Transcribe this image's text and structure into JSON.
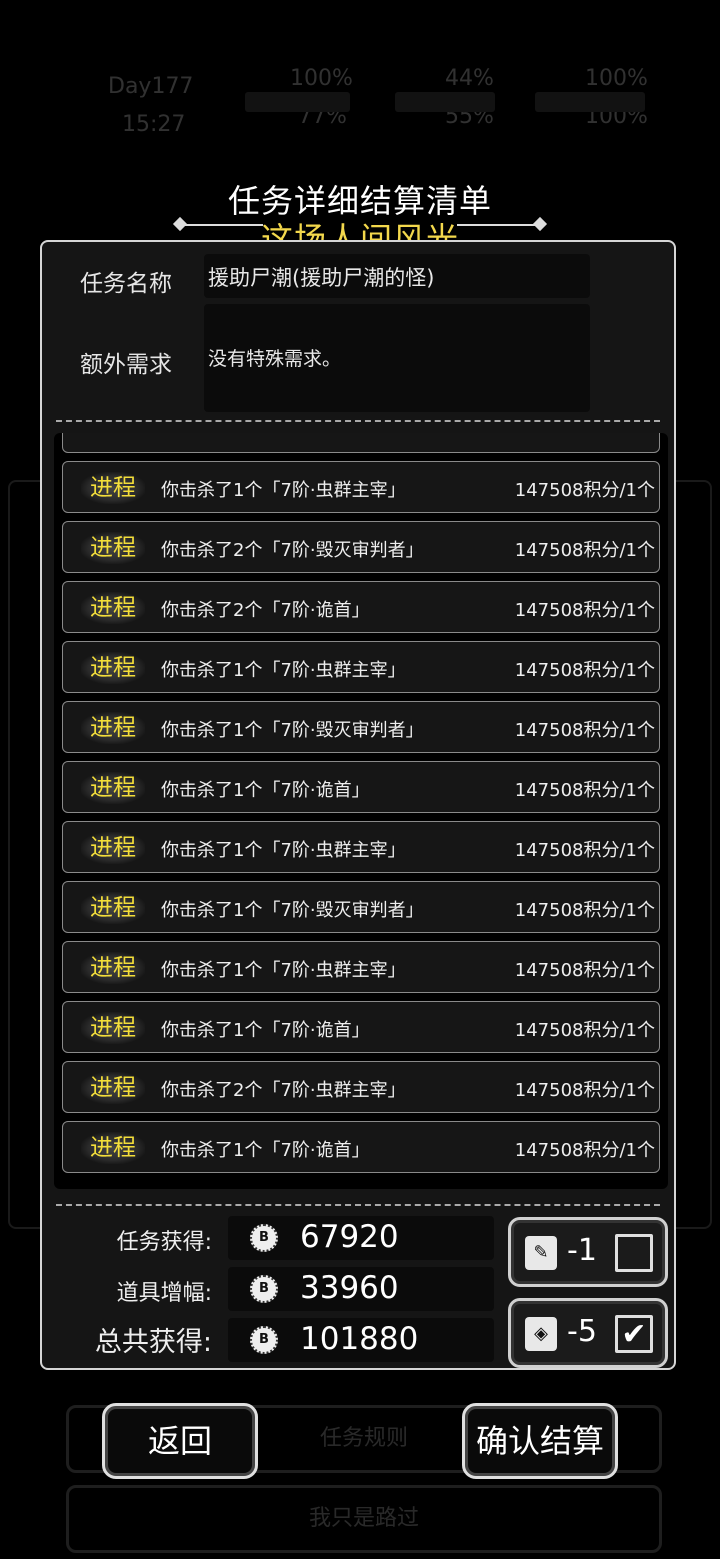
{
  "background": {
    "stats": [
      "Day177",
      "15:27",
      "100%",
      "77%",
      "44%",
      "55%",
      "100%",
      "100%"
    ],
    "center_button": "任务规则",
    "bottom_button": "我只是路过"
  },
  "header": {
    "title": "任务详细结算清单",
    "subtitle": "这场人间风光"
  },
  "task": {
    "name_label": "任务名称",
    "name_value": "援助尸潮(援助尸潮的怪)",
    "extra_label": "额外需求",
    "extra_value": "没有特殊需求。"
  },
  "progress": {
    "tag": "进程",
    "rows": [
      {
        "desc": "你击杀了1个「7阶·虫群主宰」",
        "points": "147508积分/1个"
      },
      {
        "desc": "你击杀了2个「7阶·毁灭审判者」",
        "points": "147508积分/1个"
      },
      {
        "desc": "你击杀了2个「7阶·诡首」",
        "points": "147508积分/1个"
      },
      {
        "desc": "你击杀了1个「7阶·虫群主宰」",
        "points": "147508积分/1个"
      },
      {
        "desc": "你击杀了1个「7阶·毁灭审判者」",
        "points": "147508积分/1个"
      },
      {
        "desc": "你击杀了1个「7阶·诡首」",
        "points": "147508积分/1个"
      },
      {
        "desc": "你击杀了1个「7阶·虫群主宰」",
        "points": "147508积分/1个"
      },
      {
        "desc": "你击杀了1个「7阶·毁灭审判者」",
        "points": "147508积分/1个"
      },
      {
        "desc": "你击杀了1个「7阶·虫群主宰」",
        "points": "147508积分/1个"
      },
      {
        "desc": "你击杀了1个「7阶·诡首」",
        "points": "147508积分/1个"
      },
      {
        "desc": "你击杀了2个「7阶·虫群主宰」",
        "points": "147508积分/1个"
      },
      {
        "desc": "你击杀了1个「7阶·诡首」",
        "points": "147508积分/1个"
      }
    ]
  },
  "summary": {
    "task_label": "任务获得:",
    "task_value": "67920",
    "item_label": "道具增幅:",
    "item_value": "33960",
    "total_label": "总共获得:",
    "total_value": "101880",
    "coin_icon": "B"
  },
  "toggles": [
    {
      "icon": "scroll-icon",
      "value": "-1",
      "checked": false
    },
    {
      "icon": "card-icon",
      "value": "-5",
      "checked": true
    }
  ],
  "buttons": {
    "back": "返回",
    "confirm": "确认结算"
  }
}
